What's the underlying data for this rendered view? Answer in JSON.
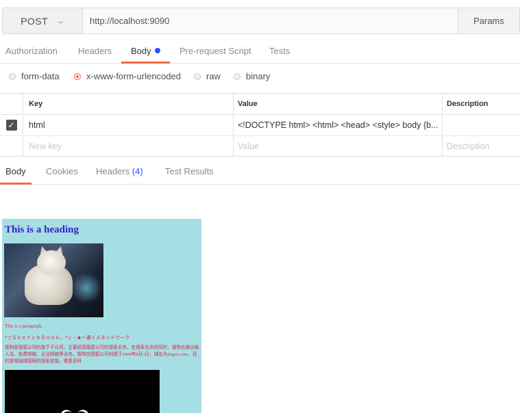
{
  "request": {
    "method": "POST",
    "url": "http://localhost:9090",
    "params_label": "Params"
  },
  "request_tabs": [
    {
      "label": "Authorization",
      "active": false
    },
    {
      "label": "Headers",
      "active": false
    },
    {
      "label": "Body",
      "active": true,
      "modified": true
    },
    {
      "label": "Pre-request Script",
      "active": false
    },
    {
      "label": "Tests",
      "active": false
    }
  ],
  "body_types": [
    {
      "label": "form-data",
      "selected": false
    },
    {
      "label": "x-www-form-urlencoded",
      "selected": true
    },
    {
      "label": "raw",
      "selected": false
    },
    {
      "label": "binary",
      "selected": false
    }
  ],
  "kv_table": {
    "headers": {
      "key": "Key",
      "value": "Value",
      "description": "Description"
    },
    "rows": [
      {
        "checked": true,
        "key": "html",
        "value": "<!DOCTYPE html> <html> <head> <style> body {b...",
        "description": ""
      }
    ],
    "placeholders": {
      "key": "New key",
      "value": "Value",
      "description": "Description"
    }
  },
  "response_tabs": [
    {
      "label": "Body",
      "active": true
    },
    {
      "label": "Cookies",
      "active": false
    },
    {
      "label": "Headers",
      "count": "(4)",
      "active": false
    },
    {
      "label": "Test Results",
      "active": false
    }
  ],
  "preview": {
    "heading": "This is a heading",
    "paragraph": "This is a paragraph.",
    "line2": "*☆ＳｋｅｔｃｈＢｏｏｋ。*☆・★～書く人ネットワーク",
    "line3": "搜狗是搜狐公司的旗下子公司，主要经营搜狐公司的搜索业务。在搜索业务的同时，搜狗也推出输入法、免费邮箱、企业邮箱等业务。搜狗由搜狐公司创建于2004年8月3日，域名为Sogou.com，目的是增强搜狐网的搜索技能。维基百科",
    "background_color": "#a6dfe3"
  },
  "colors": {
    "accent": "#f26b3a",
    "dot": "#2b4fff",
    "preview_heading": "#3a1cc7",
    "preview_text": "#e0204a"
  }
}
